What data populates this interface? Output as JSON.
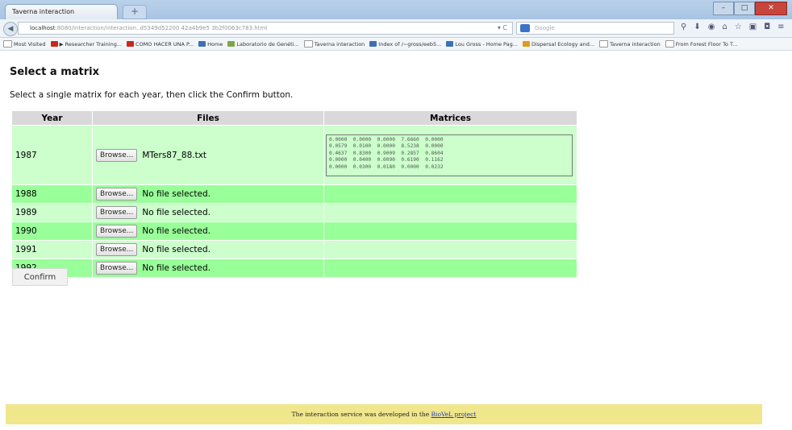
{
  "browser": {
    "tab_title": "Taverna interaction",
    "new_tab": "+",
    "url_host": "localhost",
    "url_rest": ":8080/interaction/interaction..d5349d52200 42a4b9e5 3b2f0063c783.html",
    "search_placeholder": "Google",
    "bookmarks": [
      {
        "label": "Most Visited",
        "icon": "p"
      },
      {
        "label": "▶ Researcher Training...",
        "icon": "r"
      },
      {
        "label": "COMO HACER UNA P...",
        "icon": "r"
      },
      {
        "label": "Home",
        "icon": "b"
      },
      {
        "label": "Laboratorio de Genéti...",
        "icon": "g"
      },
      {
        "label": "Taverna interaction",
        "icon": "p"
      },
      {
        "label": "Index of /~gross/eeb5...",
        "icon": "b"
      },
      {
        "label": "Lou Gross - Home Pag...",
        "icon": "b"
      },
      {
        "label": "Dispersal Ecology and...",
        "icon": "o"
      },
      {
        "label": "Taverna interaction",
        "icon": "p"
      },
      {
        "label": "From Forest Floor To T...",
        "icon": "p"
      }
    ]
  },
  "page": {
    "title": "Select a matrix",
    "instructions": "Select a single matrix for each year, then click the Confirm button.",
    "columns": [
      "Year",
      "Files",
      "Matrices"
    ],
    "browse_label": "Browse...",
    "confirm_label": "Confirm",
    "rows": [
      {
        "year": "1987",
        "file": "MTers87_88.txt",
        "matrix": "0.0000  0.0000  0.0000  7.6660  0.0000\n0.0579  0.0100  0.0000  8.5238  0.0000\n0.4637  0.8300  0.9009  0.2857  0.8604\n0.0000  0.0400  0.0090  0.6190  0.1162\n0.0000  0.0300  0.0180  0.0000  0.0232"
      },
      {
        "year": "1988",
        "file": "No file selected.",
        "matrix": ""
      },
      {
        "year": "1989",
        "file": "No file selected.",
        "matrix": ""
      },
      {
        "year": "1990",
        "file": "No file selected.",
        "matrix": ""
      },
      {
        "year": "1991",
        "file": "No file selected.",
        "matrix": ""
      },
      {
        "year": "1992",
        "file": "No file selected.",
        "matrix": ""
      }
    ]
  },
  "footer": {
    "text": "The interaction service was developed in the",
    "link": "BioVeL project"
  }
}
